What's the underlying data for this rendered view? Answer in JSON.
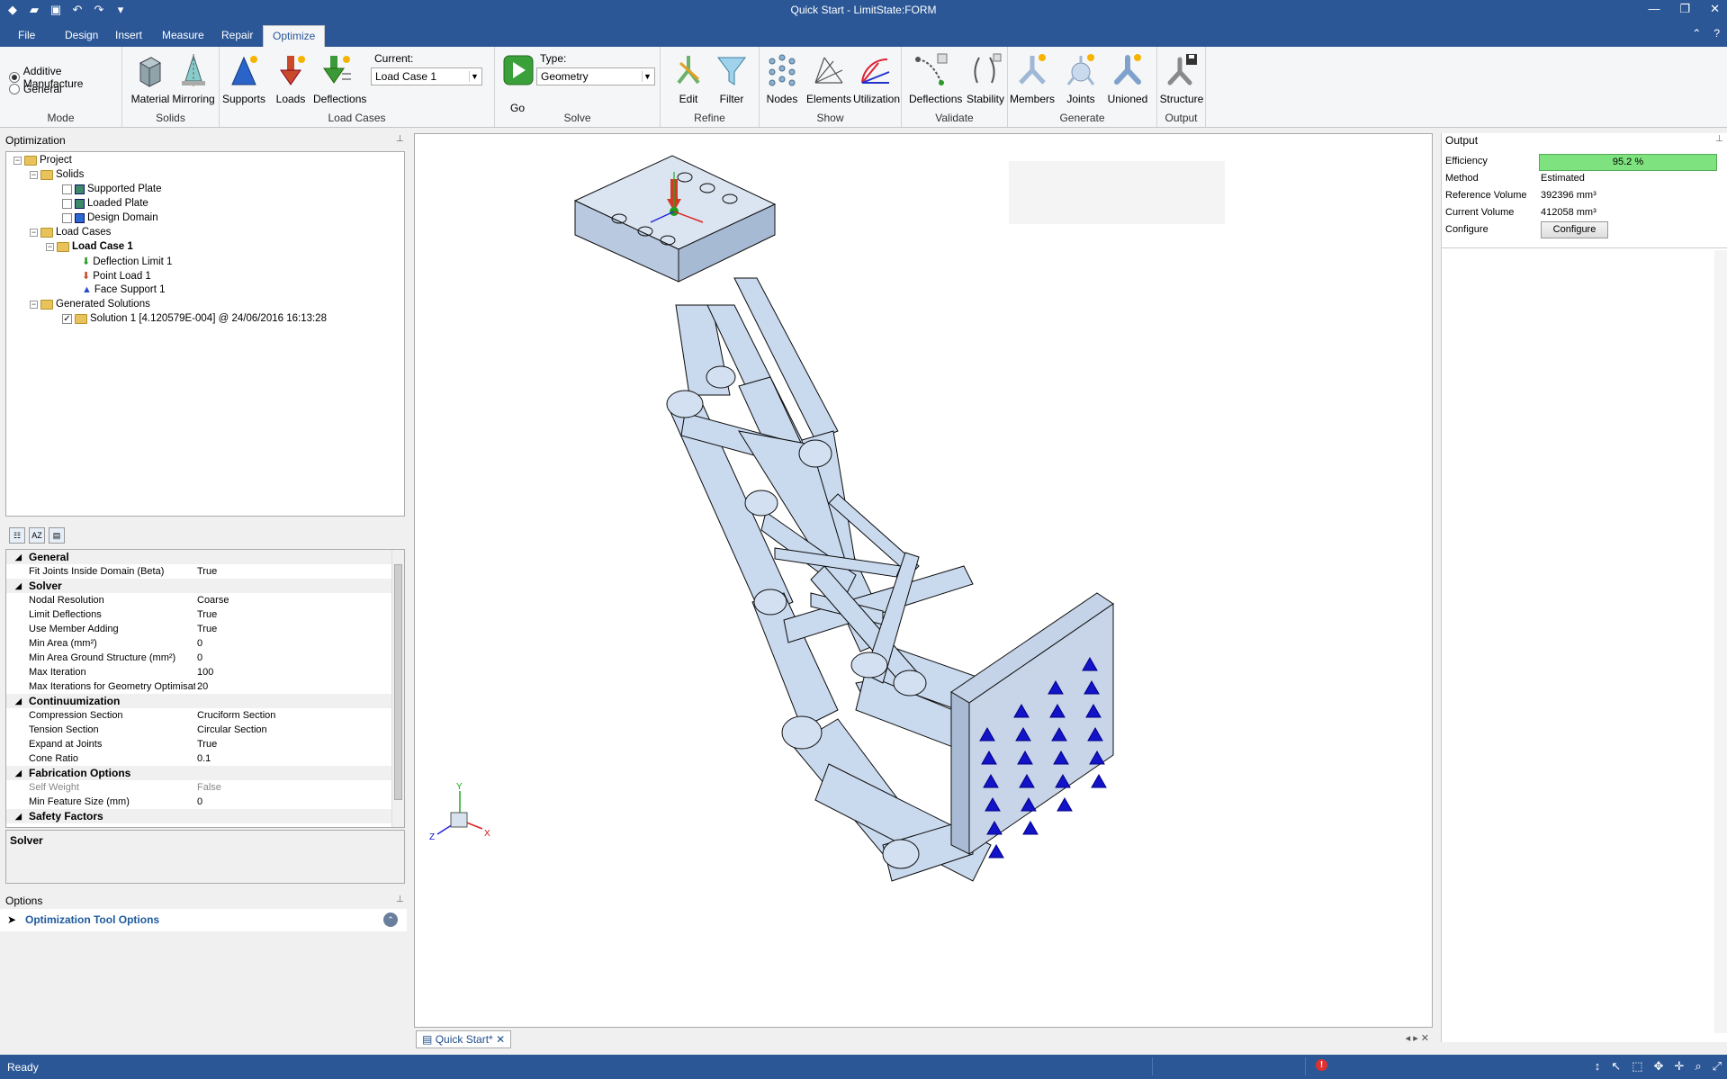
{
  "window": {
    "title": "Quick Start - LimitState:FORM"
  },
  "ribbon_tabs": [
    "File",
    "Design",
    "Insert",
    "Measure",
    "Repair",
    "Optimize"
  ],
  "active_tab": "Optimize",
  "mode": {
    "options": [
      "Additive Manufacture",
      "General"
    ],
    "selected": "Additive Manufacture",
    "group_label": "Mode"
  },
  "solids_group": {
    "label": "Solids",
    "buttons": [
      "Material",
      "Mirroring"
    ]
  },
  "load_cases_group": {
    "label": "Load Cases",
    "buttons": [
      "Supports",
      "Loads",
      "Deflections"
    ],
    "current_label": "Current:",
    "current_value": "Load Case 1"
  },
  "solve_group": {
    "label": "Solve",
    "go": "Go",
    "type_label": "Type:",
    "type_value": "Geometry"
  },
  "refine_group": {
    "label": "Refine",
    "buttons": [
      "Edit",
      "Filter"
    ]
  },
  "show_group": {
    "label": "Show",
    "buttons": [
      "Nodes",
      "Elements",
      "Utilization"
    ]
  },
  "validate_group": {
    "label": "Validate",
    "buttons": [
      "Deflections",
      "Stability"
    ]
  },
  "generate_group": {
    "label": "Generate",
    "buttons": [
      "Members",
      "Joints",
      "Unioned"
    ]
  },
  "output_group": {
    "label": "Output",
    "buttons": [
      "Structure"
    ]
  },
  "optimization_panel": {
    "title": "Optimization",
    "tree": {
      "project": "Project",
      "solids": "Solids",
      "supported_plate": "Supported Plate",
      "loaded_plate": "Loaded Plate",
      "design_domain": "Design Domain",
      "load_cases": "Load Cases",
      "load_case_1": "Load Case 1",
      "deflection_limit": "Deflection Limit 1",
      "point_load": "Point Load 1",
      "face_support": "Face Support 1",
      "generated_solutions": "Generated Solutions",
      "solution_1": "Solution 1 [4.120579E-004] @ 24/06/2016 16:13:28"
    }
  },
  "properties": {
    "general": "General",
    "fit_joints_k": "Fit Joints Inside Domain (Beta)",
    "fit_joints_v": "True",
    "solver": "Solver",
    "nodal_res_k": "Nodal Resolution",
    "nodal_res_v": "Coarse",
    "limit_defl_k": "Limit Deflections",
    "limit_defl_v": "True",
    "member_add_k": "Use Member Adding",
    "member_add_v": "True",
    "min_area_k": "Min Area (mm²)",
    "min_area_v": "0",
    "min_area_gs_k": "Min Area Ground Structure (mm²)",
    "min_area_gs_v": "0",
    "max_iter_k": "Max Iteration",
    "max_iter_v": "100",
    "max_iter_geo_k": "Max Iterations for Geometry Optimisatic",
    "max_iter_geo_v": "20",
    "continuumization": "Continuumization",
    "comp_sec_k": "Compression Section",
    "comp_sec_v": "Cruciform Section",
    "tens_sec_k": "Tension Section",
    "tens_sec_v": "Circular Section",
    "expand_k": "Expand at Joints",
    "expand_v": "True",
    "cone_k": "Cone Ratio",
    "cone_v": "0.1",
    "fabrication": "Fabrication Options",
    "self_weight_k": "Self Weight",
    "self_weight_v": "False",
    "min_feat_k": "Min Feature Size (mm)",
    "min_feat_v": "0",
    "safety": "Safety Factors"
  },
  "description_box": {
    "title": "Solver"
  },
  "options_panel": {
    "title": "Options",
    "item": "Optimization Tool Options"
  },
  "document_tab": "Quick Start*",
  "output_panel": {
    "title": "Output",
    "efficiency_label": "Efficiency",
    "efficiency_value": "95.2 %",
    "efficiency_fraction": 0.952,
    "method_label": "Method",
    "method_value": "Estimated",
    "ref_vol_label": "Reference Volume",
    "ref_vol_value": "392396 mm³",
    "cur_vol_label": "Current Volume",
    "cur_vol_value": "412058 mm³",
    "configure_label": "Configure",
    "configure_button": "Configure"
  },
  "triad": {
    "x": "X",
    "y": "Y",
    "z": "Z"
  },
  "status": {
    "text": "Ready",
    "error_icon": "!"
  },
  "colors": {
    "titlebar": "#2b5797",
    "efficiency_bar": "#7ee27e",
    "structure": "#c9d9ee",
    "support_cones": "#1010c8"
  }
}
